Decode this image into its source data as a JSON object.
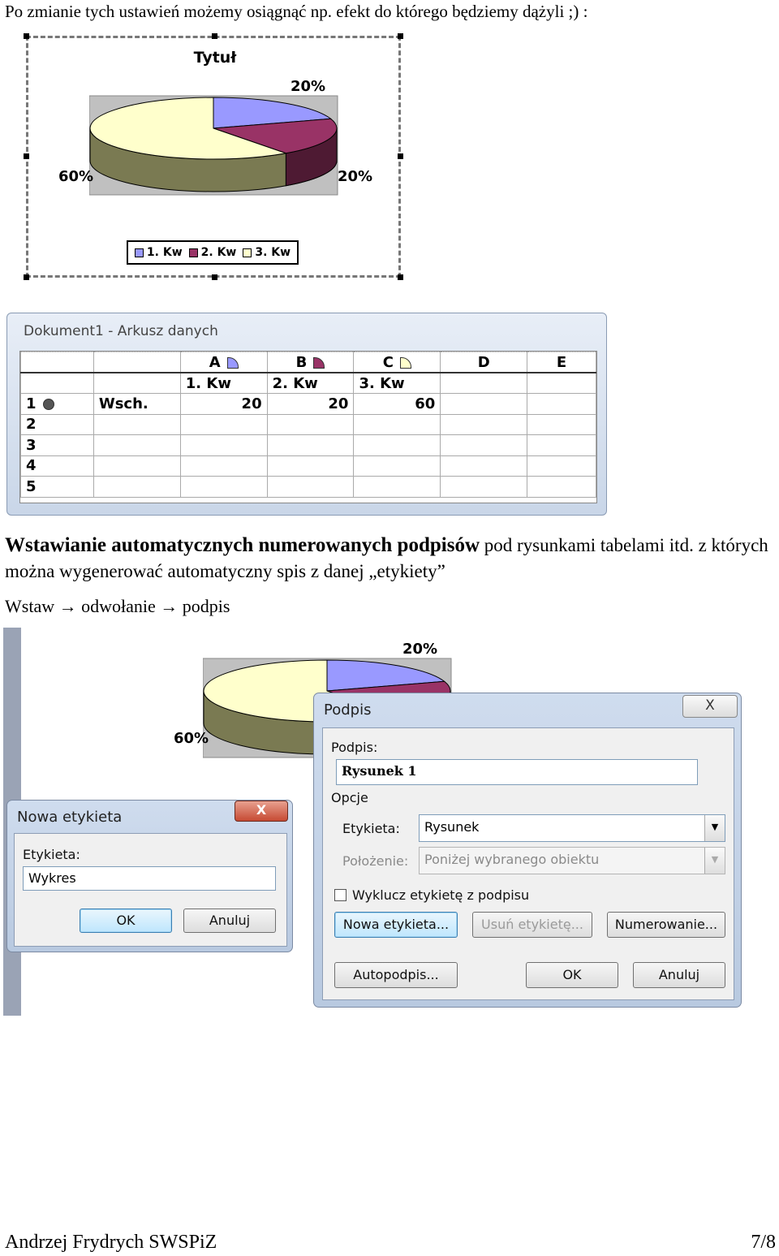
{
  "intro": "Po zmianie tych ustawień możemy osiągnąć np. efekt do którego będziemy dążyli ;) :",
  "chart": {
    "title": "Tytuł",
    "labels": [
      "20%",
      "20%",
      "60%"
    ],
    "legend": [
      "1. Kw",
      "2. Kw",
      "3. Kw"
    ],
    "colors": [
      "#9999ff",
      "#993366",
      "#ffffcc"
    ]
  },
  "chart_data": {
    "type": "pie",
    "title": "Tytuł",
    "categories": [
      "1. Kw",
      "2. Kw",
      "3. Kw"
    ],
    "values": [
      20,
      20,
      60
    ],
    "labels": [
      "20%",
      "20%",
      "60%"
    ],
    "legend_position": "bottom"
  },
  "sheet": {
    "title": "Dokument1 - Arkusz danych",
    "columns": [
      "A",
      "B",
      "C",
      "D",
      "E"
    ],
    "series_headers": [
      "1. Kw",
      "2. Kw",
      "3. Kw"
    ],
    "rows": [
      "1",
      "2",
      "3",
      "4",
      "5"
    ],
    "row1_label": "Wsch.",
    "row1_values": [
      "20",
      "20",
      "60"
    ]
  },
  "section": {
    "heading": "Wstawianie automatycznych numerowanych podpisów",
    "text": " pod rysunkami tabelami itd. z których można wygenerować automatyczny spis z danej „etykiety”",
    "path": "Wstaw → odwołanie → podpis"
  },
  "bottom_chart": {
    "labels": [
      "20%",
      "60%"
    ]
  },
  "nowa_etykieta": {
    "title": "Nowa etykieta",
    "close": "X",
    "label": "Etykieta:",
    "value": "Wykres",
    "ok": "OK",
    "cancel": "Anuluj"
  },
  "podpis": {
    "title": "Podpis",
    "close": "X",
    "caption_label": "Podpis:",
    "caption_value": "Rysunek 1",
    "options_label": "Opcje",
    "label_label": "Etykieta:",
    "label_value": "Rysunek",
    "position_label": "Położenie:",
    "position_value": "Poniżej wybranego obiektu",
    "exclude_label": "Wyklucz etykietę z podpisu",
    "new_label_btn": "Nowa etykieta...",
    "delete_label_btn": "Usuń etykietę...",
    "numbering_btn": "Numerowanie...",
    "autocaption_btn": "Autopodpis...",
    "ok": "OK",
    "cancel": "Anuluj"
  },
  "footer": {
    "author": "Andrzej Frydrych SWSPiZ",
    "page": "7/8"
  }
}
